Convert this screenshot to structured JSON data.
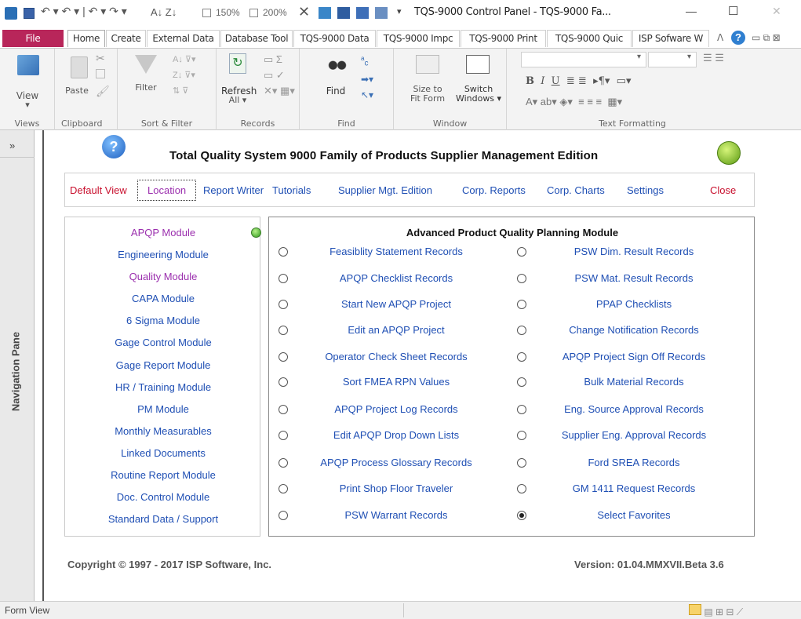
{
  "window": {
    "title": "TQS-9000 Control Panel - TQS-9000 Fa...",
    "qat_zoom_150": "150%",
    "qat_zoom_200": "200%",
    "min": "—",
    "max": "☐",
    "close": "✕"
  },
  "tabs": [
    "File",
    "Home",
    "Create",
    "External Data",
    "Database Tool",
    "TQS-9000 Data",
    "TQS-9000 Impc",
    "TQS-9000 Print",
    "TQS-9000 Quic",
    "ISP Sofware W"
  ],
  "ribbon": {
    "views": {
      "view_label": "View",
      "group": "Views"
    },
    "clipboard": {
      "paste_label": "Paste",
      "group": "Clipboard"
    },
    "sort": {
      "filter_label": "Filter",
      "group": "Sort & Filter"
    },
    "records": {
      "refresh_label": "Refresh",
      "refresh_sub": "All ▾",
      "group": "Records"
    },
    "find": {
      "find_label": "Find",
      "group": "Find"
    },
    "window": {
      "size_label1": "Size to",
      "size_label2": "Fit Form",
      "switch_label1": "Switch",
      "switch_label2": "Windows ▾",
      "group": "Window"
    },
    "text": {
      "group": "Text Formatting"
    }
  },
  "navpane": {
    "toggle": "»",
    "label": "Navigation Pane"
  },
  "form": {
    "title": "Total Quality System 9000 Family of Products Supplier Management Edition",
    "menu": [
      "Default View",
      "Location",
      "Report Writer",
      "Tutorials",
      "Supplier Mgt. Edition",
      "Corp. Reports",
      "Corp. Charts",
      "Settings",
      "Close"
    ],
    "modules": [
      "APQP Module",
      "Engineering Module",
      "Quality Module",
      "CAPA Module",
      "6 Sigma Module",
      "Gage Control Module",
      "Gage Report Module",
      "HR / Training Module",
      "PM Module",
      "Monthly Measurables",
      "Linked Documents",
      "Routine Report Module",
      "Doc. Control Module",
      "Standard Data / Support"
    ],
    "panel_title": "Advanced Product Quality Planning Module",
    "records_left": [
      "Feasiblity Statement Records",
      "APQP Checklist Records",
      "Start New APQP Project",
      "Edit an APQP Project",
      "Operator Check Sheet Records",
      "Sort FMEA RPN Values",
      "APQP Project Log Records",
      "Edit APQP Drop Down Lists",
      "APQP Process Glossary Records",
      "Print Shop Floor Traveler",
      "PSW Warrant Records"
    ],
    "records_right": [
      "PSW Dim. Result Records",
      "PSW Mat. Result Records",
      "PPAP Checklists",
      "Change Notification Records",
      "APQP Project Sign Off Records",
      "Bulk Material Records",
      "Eng. Source Approval Records",
      "Supplier Eng. Approval Records",
      "Ford SREA Records",
      "GM 1411 Request Records",
      "Select Favorites"
    ],
    "copyright": "Copyright © 1997 - 2017 ISP Software, Inc.",
    "version": "Version: 01.04.MMXVII.Beta 3.6"
  },
  "status": {
    "left": "Form View"
  },
  "colors": {
    "file_tab": "#b8265a",
    "link": "#1f4fb4",
    "purple": "#9b2fae",
    "red": "#c8102e"
  }
}
